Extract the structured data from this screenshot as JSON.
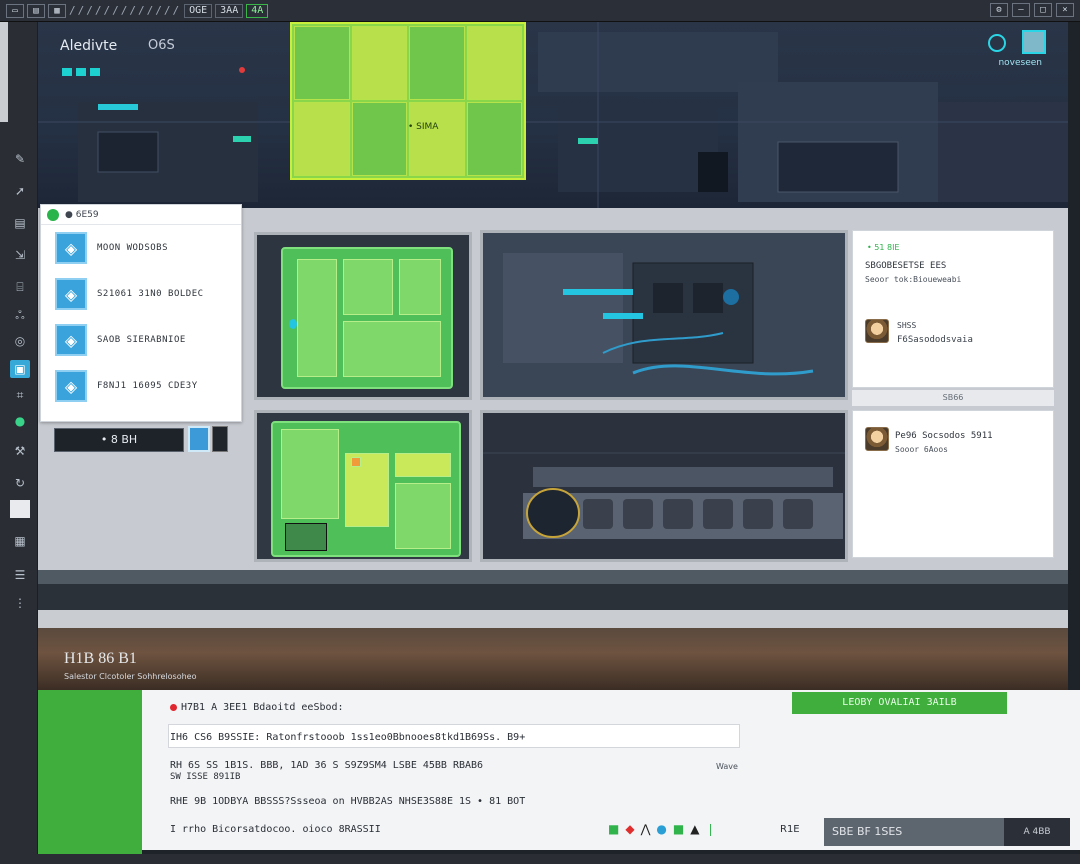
{
  "topbar": {
    "buttons": [
      "⬚",
      "⬚",
      "⬚"
    ],
    "tabs": [
      "OGE",
      "3AA"
    ],
    "status": "4A"
  },
  "hero": {
    "title": "Aledivte",
    "subtitle": "O6S",
    "green_label": "• SIMA",
    "right_label": "noveseen"
  },
  "left_card": {
    "header": "● 6E59",
    "items": [
      {
        "label": "MOON WODSOBS",
        "icon": "cube-icon"
      },
      {
        "label": "S21061 31N0 BOLDEC",
        "icon": "cube-icon"
      },
      {
        "label": "SAOB SIERABNIOE",
        "icon": "cube-icon"
      },
      {
        "label": "F8NJ1 16095 CDE3Y",
        "icon": "cube-icon"
      }
    ],
    "action_label": "• 8 BH"
  },
  "right_card_1": {
    "tag": "• 51 8IE",
    "title": "SBGOBESETSE EES",
    "subtitle": "Seoor tok:Bioueweabi",
    "name": "SHSS",
    "handle": "F6Sasododsvaia"
  },
  "separator_label": "SB66",
  "right_card_2": {
    "line1": "Pe96 Socsodos 5911",
    "line2": "Sooor 6Aoos"
  },
  "landscape": {
    "title": "H1B 86 B1",
    "subtitle": "Salestor Clcotoler Sohhrelosoheo"
  },
  "bottom": {
    "row1": "H7B1 A 3EE1 Bdaoitd eeSbod:",
    "row2": "IH6 CS6 B9SSIE: Ratonfrstooob 1ss1eo0Bbnooes8tkd1B69Ss. B9+",
    "row3": "RH 6S SS 1B1S. BBB, 1AD 36 S S9Z9SM4  LSBE 45BB  RBAB6",
    "row3b": "SW ISSE 891IB",
    "row4": "RHE 9B 1ODBYA BBSSS?Ssseoa on HVBB2AS NHSE3S88E 1S • 81 BOT",
    "row5": "I rrho Bicorsatdocoo. oioco 8RASSII",
    "note": "Wave",
    "button_label": "LEOBY  OVALIAI 3AILB",
    "right_label": "R1E",
    "dark_label": "SBE BF 1SES",
    "end_label": "A 4BB"
  },
  "colors": {
    "accent_green": "#3fae3c",
    "cyan": "#24c5e0",
    "card_bg": "#ffffff",
    "dark_bg": "#1e2229"
  }
}
